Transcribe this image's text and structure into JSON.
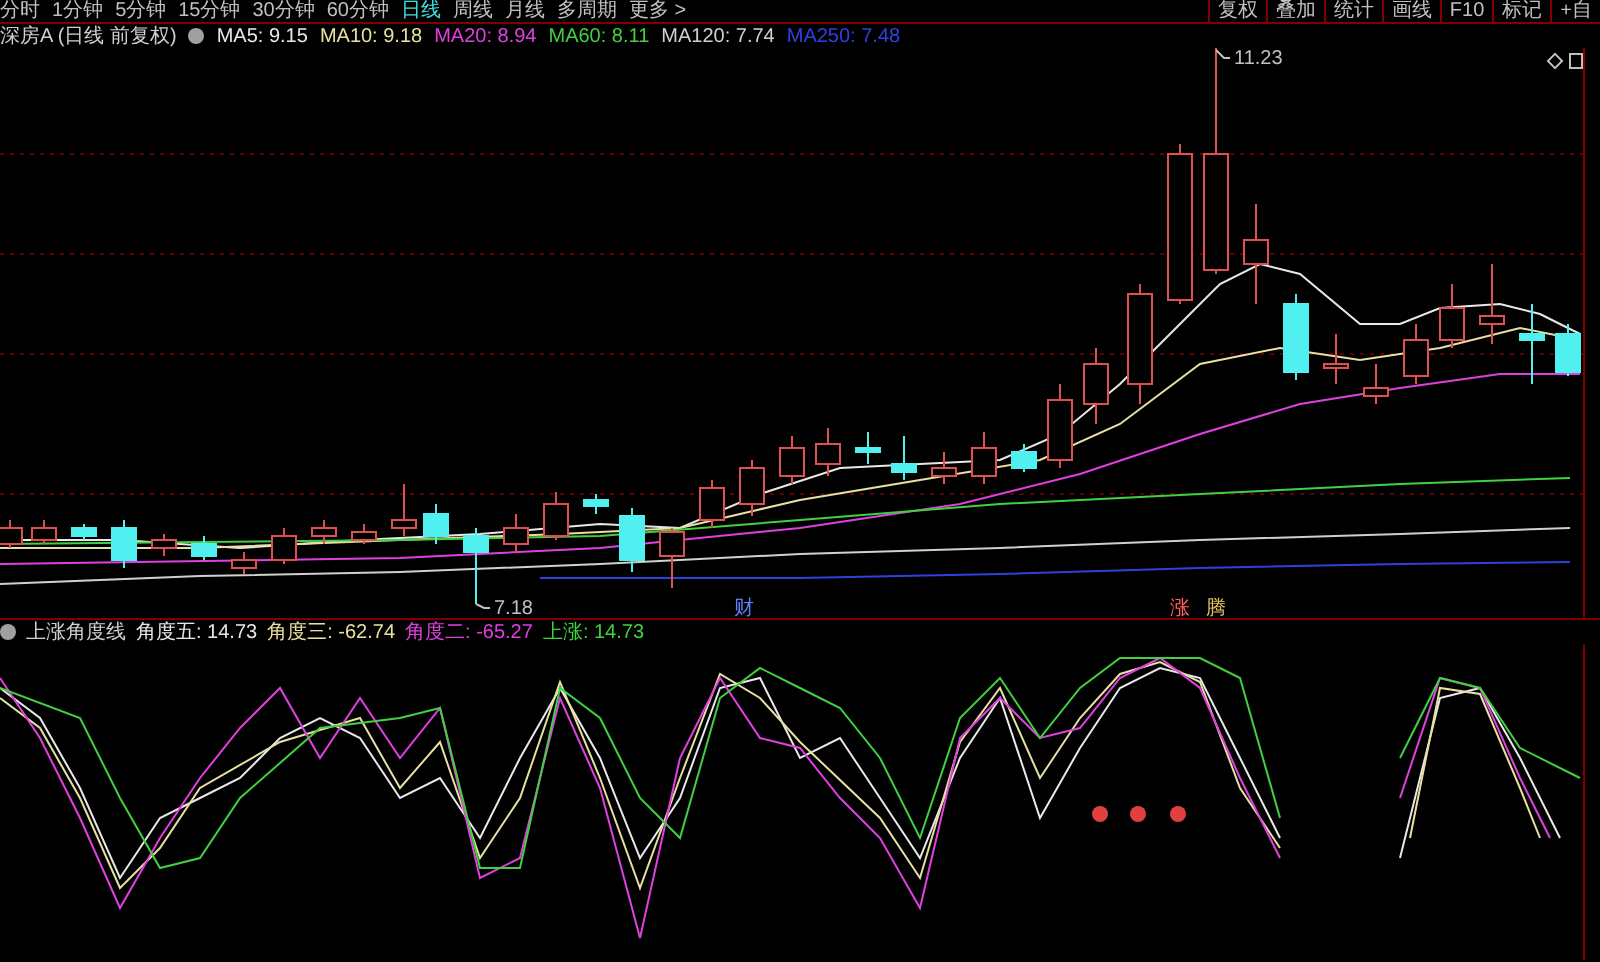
{
  "period_bar": {
    "items": [
      {
        "label": "分时",
        "selected": false
      },
      {
        "label": "1分钟",
        "selected": false
      },
      {
        "label": "5分钟",
        "selected": false
      },
      {
        "label": "15分钟",
        "selected": false
      },
      {
        "label": "30分钟",
        "selected": false
      },
      {
        "label": "60分钟",
        "selected": false
      },
      {
        "label": "日线",
        "selected": true
      },
      {
        "label": "周线",
        "selected": false
      },
      {
        "label": "月线",
        "selected": false
      },
      {
        "label": "多周期",
        "selected": false
      },
      {
        "label": "更多 >",
        "selected": false
      }
    ]
  },
  "toolbar": {
    "buttons": [
      "复权",
      "叠加",
      "统计",
      "画线",
      "F10",
      "标记",
      "+自"
    ]
  },
  "legend": {
    "title": "深房A (日线 前复权)",
    "indicators": [
      {
        "label": "MA5: 9.15",
        "color": "#e8e8e8"
      },
      {
        "label": "MA10: 9.18",
        "color": "#e8e0a0"
      },
      {
        "label": "MA20: 8.94",
        "color": "#e040e0"
      },
      {
        "label": "MA60: 8.11",
        "color": "#40d040"
      },
      {
        "label": "MA120: 7.74",
        "color": "#d0d0d0"
      },
      {
        "label": "MA250: 7.48",
        "color": "#3040e0"
      }
    ]
  },
  "price_chart": {
    "high_label": "11.23",
    "low_label": "7.18",
    "event_markers": [
      {
        "label": "财",
        "color": "#6080ff"
      },
      {
        "label": "涨",
        "color": "#ff6060"
      },
      {
        "label": "腾",
        "color": "#e0c060"
      }
    ]
  },
  "indicator_panel": {
    "title": "上涨角度线",
    "values": [
      {
        "label": "角度五: 14.73",
        "color": "#e8e8e8"
      },
      {
        "label": "角度三: -62.74",
        "color": "#e8e0a0"
      },
      {
        "label": "角度二: -65.27",
        "color": "#e040e0"
      },
      {
        "label": "上涨: 14.73",
        "color": "#40d040"
      }
    ]
  }
}
